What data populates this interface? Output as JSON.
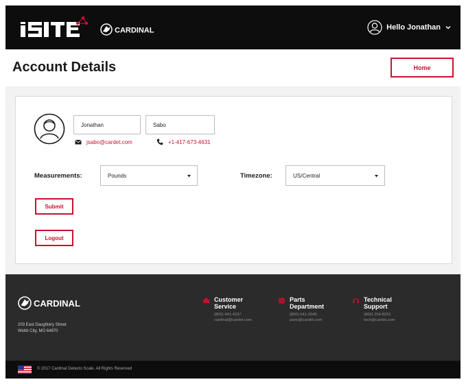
{
  "header": {
    "user_greeting": "Hello Jonathan",
    "user_icon": "user-circle-icon",
    "menu_icon": "chevron-down-icon",
    "logos": {
      "product": "iSITE",
      "brand": "CARDINAL"
    }
  },
  "titlebar": {
    "title": "Account Details",
    "home_label": "Home"
  },
  "profile": {
    "avatar_icon": "user-avatar-icon",
    "first_name": "Jonathan",
    "last_name": "Sabo",
    "email": "jsabo@cardet.com",
    "email_icon": "envelope-icon",
    "phone": "+1-417-673-4631",
    "phone_icon": "phone-icon"
  },
  "settings": {
    "measurements_label": "Measurements:",
    "measurements_value": "Pounds",
    "timezone_label": "Timezone:",
    "timezone_value": "US/Central"
  },
  "actions": {
    "submit_label": "Submit",
    "logout_label": "Logout"
  },
  "footer": {
    "brand": "CARDINAL",
    "address_line1": "203 East Daughtery Street",
    "address_line2": "Webb City, MO 64870",
    "columns": [
      {
        "title1": "Customer",
        "title2": "Service",
        "phone": "(800) 441-4237",
        "email": "cardinal@cardet.com",
        "icon": "truck-icon"
      },
      {
        "title1": "Parts",
        "title2": "Department",
        "phone": "(800) 641-2045",
        "email": "parts@cardet.com",
        "icon": "gear-icon"
      },
      {
        "title1": "Technical",
        "title2": "Support",
        "phone": "(866) 254-8261",
        "email": "tech@cardet.com",
        "icon": "headset-icon"
      }
    ],
    "copyright": "© 2017 Cardinal Detecto Scale. All Rights Reserved"
  },
  "colors": {
    "accent": "#c8102e",
    "header_bg": "#0d0d0d",
    "footer_bg": "#2b2b2b"
  }
}
